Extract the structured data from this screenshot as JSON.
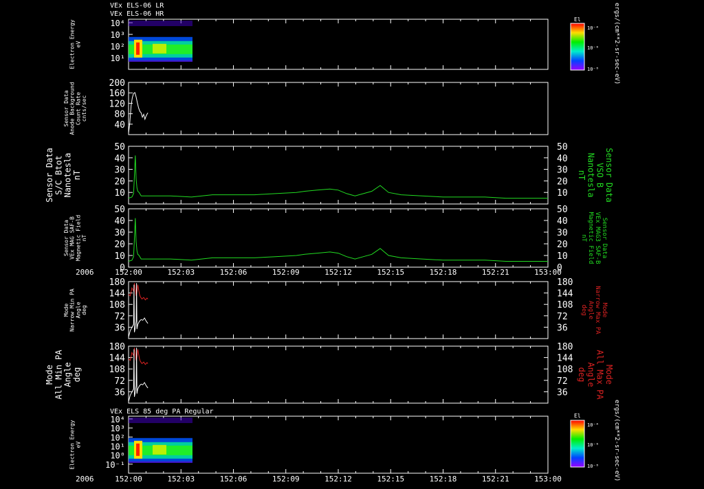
{
  "header": {
    "lines": [
      "VEx ELS-06 LR",
      "VEx ELS-06 HR"
    ],
    "bottom_title": "VEx ELS 85 deg PA Regular"
  },
  "x_axis": {
    "year": "2006",
    "tick_labels": [
      "152:00",
      "152:03",
      "152:06",
      "152:09",
      "152:12",
      "152:15",
      "152:18",
      "152:21",
      "153:00"
    ]
  },
  "colorbars": [
    {
      "title": "El",
      "ticks": [
        "10⁻⁴",
        "10⁻⁶",
        "10⁻⁸"
      ],
      "unit": "ergs/(cm**2-sr-sec-eV)"
    },
    {
      "title": "El",
      "ticks": [
        "10⁻⁴",
        "10⁻⁶",
        "10⁻⁸"
      ],
      "unit": "ergs/(cm**2-sr-sec-eV)"
    }
  ],
  "colors": {
    "white": "#ffffff",
    "green": "#22dd22",
    "red": "#dd2222"
  },
  "chart_data": [
    {
      "type": "heatmap",
      "id": "energy-lr",
      "ylabel_lines": [
        "Electron Energy",
        "eV"
      ],
      "ytick_labels": [
        "10⁴",
        "10³",
        "10²",
        "10¹"
      ],
      "data_extent_x": [
        152.0,
        152.047
      ],
      "ylim": [
        "10⁰",
        "10⁴"
      ]
    },
    {
      "type": "line",
      "id": "anode-count",
      "ylabel_lines": [
        "Sensor Data",
        "Anode Background",
        "Count Rate",
        "cnts/sec"
      ],
      "ytick_labels": [
        "200",
        "160",
        "120",
        "80",
        "40"
      ],
      "ylim": [
        20,
        200
      ],
      "series": [
        {
          "color": "white",
          "points": [
            [
              0.0,
              25
            ],
            [
              0.003,
              60
            ],
            [
              0.006,
              120
            ],
            [
              0.009,
              148
            ],
            [
              0.012,
              162
            ],
            [
              0.015,
              165
            ],
            [
              0.018,
              150
            ],
            [
              0.021,
              130
            ],
            [
              0.024,
              112
            ],
            [
              0.027,
              100
            ],
            [
              0.03,
              95
            ],
            [
              0.033,
              80
            ],
            [
              0.036,
              90
            ],
            [
              0.039,
              73
            ],
            [
              0.042,
              85
            ],
            [
              0.044,
              90
            ],
            [
              0.046,
              95
            ]
          ]
        }
      ]
    },
    {
      "type": "line",
      "id": "sc-bmag",
      "ylabel_lines": [
        "Sensor Data",
        "S/C Btot",
        "Nanotesla",
        "nT"
      ],
      "right_label_lines": [
        "Sensor Data",
        "VSO B",
        "Nanotesla",
        "nT"
      ],
      "ytick_labels": [
        "50",
        "40",
        "30",
        "20",
        "10"
      ],
      "ylim": [
        0,
        50
      ],
      "series": [
        {
          "color": "green",
          "points": [
            [
              0.0,
              5
            ],
            [
              0.008,
              6
            ],
            [
              0.012,
              9
            ],
            [
              0.014,
              24
            ],
            [
              0.016,
              42
            ],
            [
              0.018,
              22
            ],
            [
              0.02,
              14
            ],
            [
              0.022,
              11
            ],
            [
              0.025,
              10
            ],
            [
              0.03,
              7
            ],
            [
              0.05,
              7
            ],
            [
              0.1,
              7
            ],
            [
              0.15,
              6
            ],
            [
              0.2,
              8
            ],
            [
              0.25,
              8
            ],
            [
              0.3,
              8
            ],
            [
              0.35,
              9
            ],
            [
              0.4,
              10
            ],
            [
              0.42,
              11
            ],
            [
              0.45,
              12
            ],
            [
              0.48,
              13
            ],
            [
              0.5,
              12
            ],
            [
              0.52,
              9
            ],
            [
              0.54,
              7
            ],
            [
              0.56,
              9
            ],
            [
              0.58,
              11
            ],
            [
              0.6,
              16
            ],
            [
              0.62,
              10
            ],
            [
              0.65,
              8
            ],
            [
              0.7,
              7
            ],
            [
              0.75,
              6
            ],
            [
              0.8,
              6
            ],
            [
              0.85,
              6
            ],
            [
              0.9,
              5
            ],
            [
              0.95,
              5
            ],
            [
              1.0,
              5
            ]
          ]
        }
      ]
    },
    {
      "type": "line",
      "id": "mag-bfield",
      "ylabel_lines": [
        "Sensor Data",
        "VEx MAG SAF-B",
        "Magnetic Field",
        "nT"
      ],
      "right_label_lines": [
        "Sensor Data",
        "VEx MAG3 SAF-B",
        "Magnetic Field",
        "nT"
      ],
      "ytick_labels": [
        "50",
        "40",
        "30",
        "20",
        "10",
        "0"
      ],
      "ylim": [
        0,
        50
      ],
      "series": [
        {
          "color": "green",
          "points": [
            [
              0.0,
              5
            ],
            [
              0.008,
              6
            ],
            [
              0.012,
              9
            ],
            [
              0.014,
              24
            ],
            [
              0.016,
              42
            ],
            [
              0.018,
              22
            ],
            [
              0.02,
              14
            ],
            [
              0.022,
              11
            ],
            [
              0.025,
              10
            ],
            [
              0.03,
              7
            ],
            [
              0.05,
              7
            ],
            [
              0.1,
              7
            ],
            [
              0.15,
              6
            ],
            [
              0.2,
              8
            ],
            [
              0.25,
              8
            ],
            [
              0.3,
              8
            ],
            [
              0.35,
              9
            ],
            [
              0.4,
              10
            ],
            [
              0.42,
              11
            ],
            [
              0.45,
              12
            ],
            [
              0.48,
              13
            ],
            [
              0.5,
              12
            ],
            [
              0.52,
              9
            ],
            [
              0.54,
              7
            ],
            [
              0.56,
              9
            ],
            [
              0.58,
              11
            ],
            [
              0.6,
              16
            ],
            [
              0.62,
              10
            ],
            [
              0.65,
              8
            ],
            [
              0.7,
              7
            ],
            [
              0.75,
              6
            ],
            [
              0.8,
              6
            ],
            [
              0.85,
              6
            ],
            [
              0.9,
              5
            ],
            [
              0.95,
              5
            ],
            [
              1.0,
              5
            ]
          ]
        }
      ]
    },
    {
      "type": "line",
      "id": "narrow-pa",
      "ylabel_lines": [
        "Mode",
        "Narrow Min PA",
        "Angle",
        "deg"
      ],
      "right_label_lines": [
        "Mode",
        "Narrow Max PA",
        "Angle",
        "deg"
      ],
      "ytick_labels": [
        "180",
        "144",
        "108",
        "72",
        "36"
      ],
      "ylim": [
        0,
        180
      ],
      "series": [
        {
          "color": "red",
          "points": [
            [
              0.0,
              140
            ],
            [
              0.004,
              135
            ],
            [
              0.008,
              160
            ],
            [
              0.012,
              150
            ],
            [
              0.014,
              175
            ],
            [
              0.016,
              155
            ],
            [
              0.018,
              135
            ],
            [
              0.02,
              148
            ],
            [
              0.022,
              170
            ],
            [
              0.024,
              155
            ],
            [
              0.026,
              140
            ],
            [
              0.028,
              132
            ],
            [
              0.032,
              125
            ],
            [
              0.036,
              130
            ],
            [
              0.04,
              122
            ],
            [
              0.044,
              128
            ],
            [
              0.046,
              125
            ]
          ]
        },
        {
          "color": "white",
          "points": [
            [
              0.0,
              5
            ],
            [
              0.004,
              25
            ],
            [
              0.008,
              35
            ],
            [
              0.012,
              45
            ],
            [
              0.013,
              170
            ],
            [
              0.014,
              20
            ],
            [
              0.016,
              35
            ],
            [
              0.018,
              55
            ],
            [
              0.019,
              175
            ],
            [
              0.02,
              30
            ],
            [
              0.022,
              45
            ],
            [
              0.026,
              55
            ],
            [
              0.03,
              60
            ],
            [
              0.034,
              58
            ],
            [
              0.038,
              65
            ],
            [
              0.042,
              55
            ],
            [
              0.046,
              48
            ]
          ]
        }
      ]
    },
    {
      "type": "line",
      "id": "all-pa",
      "ylabel_lines": [
        "Mode",
        "All Min PA",
        "Angle",
        "deg"
      ],
      "right_label_lines": [
        "Mode",
        "All Max PA",
        "Angle",
        "deg"
      ],
      "ytick_labels": [
        "180",
        "144",
        "108",
        "72",
        "36"
      ],
      "ylim": [
        0,
        180
      ],
      "series": [
        {
          "color": "red",
          "points": [
            [
              0.0,
              140
            ],
            [
              0.004,
              135
            ],
            [
              0.008,
              160
            ],
            [
              0.012,
              150
            ],
            [
              0.014,
              175
            ],
            [
              0.016,
              155
            ],
            [
              0.018,
              135
            ],
            [
              0.02,
              148
            ],
            [
              0.022,
              170
            ],
            [
              0.024,
              155
            ],
            [
              0.026,
              140
            ],
            [
              0.028,
              132
            ],
            [
              0.032,
              125
            ],
            [
              0.036,
              130
            ],
            [
              0.04,
              122
            ],
            [
              0.044,
              128
            ],
            [
              0.046,
              125
            ]
          ]
        },
        {
          "color": "white",
          "points": [
            [
              0.0,
              5
            ],
            [
              0.004,
              25
            ],
            [
              0.008,
              35
            ],
            [
              0.012,
              45
            ],
            [
              0.013,
              170
            ],
            [
              0.014,
              20
            ],
            [
              0.016,
              35
            ],
            [
              0.018,
              55
            ],
            [
              0.019,
              175
            ],
            [
              0.02,
              30
            ],
            [
              0.022,
              45
            ],
            [
              0.026,
              55
            ],
            [
              0.03,
              60
            ],
            [
              0.034,
              58
            ],
            [
              0.038,
              65
            ],
            [
              0.042,
              55
            ],
            [
              0.046,
              48
            ]
          ]
        }
      ]
    },
    {
      "type": "heatmap",
      "id": "energy-85pa",
      "ylabel_lines": [
        "Electron Energy",
        "eV"
      ],
      "ytick_labels": [
        "10⁴",
        "10³",
        "10²",
        "10¹",
        "10⁰",
        "10⁻¹"
      ],
      "data_extent_x": [
        152.0,
        152.047
      ],
      "ylim": [
        "10⁻¹",
        "10⁴"
      ]
    }
  ]
}
